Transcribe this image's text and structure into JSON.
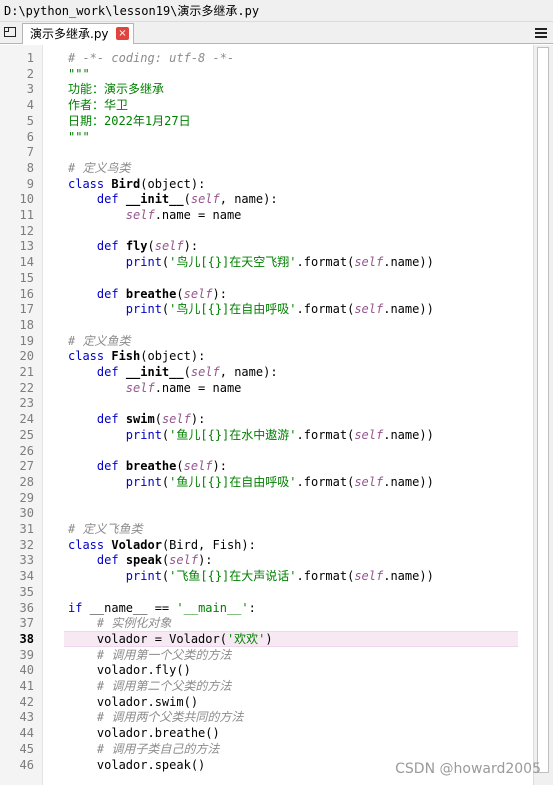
{
  "window": {
    "path": "D:\\python_work\\lesson19\\演示多继承.py"
  },
  "tab": {
    "label": "演示多继承.py",
    "close_glyph": "×"
  },
  "watermark": "CSDN @howard2005",
  "colors": {
    "keyword": "#0000c8",
    "string": "#008000",
    "comment": "#8c8c8c",
    "self": "#94558d",
    "current_line": "#f6e9f4",
    "close_button": "#e0443e"
  },
  "icons": [
    "window-icon",
    "close-icon",
    "menu-icon"
  ],
  "editor": {
    "current_line": 38,
    "lines": [
      {
        "n": "1",
        "t": [
          [
            "cm",
            "# -*- coding: utf-8 -*-"
          ]
        ]
      },
      {
        "n": "2",
        "t": [
          [
            "st",
            "\"\"\""
          ]
        ]
      },
      {
        "n": "3",
        "t": [
          [
            "st",
            "功能：演示多继承"
          ]
        ]
      },
      {
        "n": "4",
        "t": [
          [
            "st",
            "作者：华卫"
          ]
        ]
      },
      {
        "n": "5",
        "t": [
          [
            "st",
            "日期：2022年1月27日"
          ]
        ]
      },
      {
        "n": "6",
        "t": [
          [
            "st",
            "\"\"\""
          ]
        ]
      },
      {
        "n": "7",
        "t": []
      },
      {
        "n": "8",
        "t": [
          [
            "cm",
            "# 定义鸟类"
          ]
        ]
      },
      {
        "n": "9",
        "t": [
          [
            "kw",
            "class "
          ],
          [
            "fn",
            "Bird"
          ],
          [
            "",
            "(object):"
          ]
        ]
      },
      {
        "n": "10",
        "t": [
          [
            "",
            "    "
          ],
          [
            "kw",
            "def "
          ],
          [
            "fn",
            "__init__"
          ],
          [
            "",
            "("
          ],
          [
            "sf",
            "self"
          ],
          [
            "",
            ", name):"
          ]
        ]
      },
      {
        "n": "11",
        "t": [
          [
            "",
            "        "
          ],
          [
            "sf",
            "self"
          ],
          [
            "",
            ".name = name"
          ]
        ]
      },
      {
        "n": "12",
        "t": []
      },
      {
        "n": "13",
        "t": [
          [
            "",
            "    "
          ],
          [
            "kw",
            "def "
          ],
          [
            "fn",
            "fly"
          ],
          [
            "",
            "("
          ],
          [
            "sf",
            "self"
          ],
          [
            "",
            "):"
          ]
        ]
      },
      {
        "n": "14",
        "t": [
          [
            "",
            "        "
          ],
          [
            "kw",
            "print"
          ],
          [
            "",
            "("
          ],
          [
            "st",
            "'鸟儿[{}]在天空飞翔'"
          ],
          [
            "",
            ".format("
          ],
          [
            "sf",
            "self"
          ],
          [
            "",
            ".name))"
          ]
        ]
      },
      {
        "n": "15",
        "t": []
      },
      {
        "n": "16",
        "t": [
          [
            "",
            "    "
          ],
          [
            "kw",
            "def "
          ],
          [
            "fn",
            "breathe"
          ],
          [
            "",
            "("
          ],
          [
            "sf",
            "self"
          ],
          [
            "",
            "):"
          ]
        ]
      },
      {
        "n": "17",
        "t": [
          [
            "",
            "        "
          ],
          [
            "kw",
            "print"
          ],
          [
            "",
            "("
          ],
          [
            "st",
            "'鸟儿[{}]在自由呼吸'"
          ],
          [
            "",
            ".format("
          ],
          [
            "sf",
            "self"
          ],
          [
            "",
            ".name))"
          ]
        ]
      },
      {
        "n": "18",
        "t": []
      },
      {
        "n": "19",
        "t": [
          [
            "cm",
            "# 定义鱼类"
          ]
        ]
      },
      {
        "n": "20",
        "t": [
          [
            "kw",
            "class "
          ],
          [
            "fn",
            "Fish"
          ],
          [
            "",
            "(object):"
          ]
        ]
      },
      {
        "n": "21",
        "t": [
          [
            "",
            "    "
          ],
          [
            "kw",
            "def "
          ],
          [
            "fn",
            "__init__"
          ],
          [
            "",
            "("
          ],
          [
            "sf",
            "self"
          ],
          [
            "",
            ", name):"
          ]
        ]
      },
      {
        "n": "22",
        "t": [
          [
            "",
            "        "
          ],
          [
            "sf",
            "self"
          ],
          [
            "",
            ".name = name"
          ]
        ]
      },
      {
        "n": "23",
        "t": []
      },
      {
        "n": "24",
        "t": [
          [
            "",
            "    "
          ],
          [
            "kw",
            "def "
          ],
          [
            "fn",
            "swim"
          ],
          [
            "",
            "("
          ],
          [
            "sf",
            "self"
          ],
          [
            "",
            "):"
          ]
        ]
      },
      {
        "n": "25",
        "t": [
          [
            "",
            "        "
          ],
          [
            "kw",
            "print"
          ],
          [
            "",
            "("
          ],
          [
            "st",
            "'鱼儿[{}]在水中遨游'"
          ],
          [
            "",
            ".format("
          ],
          [
            "sf",
            "self"
          ],
          [
            "",
            ".name))"
          ]
        ]
      },
      {
        "n": "26",
        "t": []
      },
      {
        "n": "27",
        "t": [
          [
            "",
            "    "
          ],
          [
            "kw",
            "def "
          ],
          [
            "fn",
            "breathe"
          ],
          [
            "",
            "("
          ],
          [
            "sf",
            "self"
          ],
          [
            "",
            "):"
          ]
        ]
      },
      {
        "n": "28",
        "t": [
          [
            "",
            "        "
          ],
          [
            "kw",
            "print"
          ],
          [
            "",
            "("
          ],
          [
            "st",
            "'鱼儿[{}]在自由呼吸'"
          ],
          [
            "",
            ".format("
          ],
          [
            "sf",
            "self"
          ],
          [
            "",
            ".name))"
          ]
        ]
      },
      {
        "n": "29",
        "t": []
      },
      {
        "n": "30",
        "t": []
      },
      {
        "n": "31",
        "t": [
          [
            "cm",
            "# 定义飞鱼类"
          ]
        ]
      },
      {
        "n": "32",
        "t": [
          [
            "kw",
            "class "
          ],
          [
            "fn",
            "Volador"
          ],
          [
            "",
            "(Bird, Fish):"
          ]
        ]
      },
      {
        "n": "33",
        "t": [
          [
            "",
            "    "
          ],
          [
            "kw",
            "def "
          ],
          [
            "fn",
            "speak"
          ],
          [
            "",
            "("
          ],
          [
            "sf",
            "self"
          ],
          [
            "",
            "):"
          ]
        ]
      },
      {
        "n": "34",
        "t": [
          [
            "",
            "        "
          ],
          [
            "kw",
            "print"
          ],
          [
            "",
            "("
          ],
          [
            "st",
            "'飞鱼[{}]在大声说话'"
          ],
          [
            "",
            ".format("
          ],
          [
            "sf",
            "self"
          ],
          [
            "",
            ".name))"
          ]
        ]
      },
      {
        "n": "35",
        "t": []
      },
      {
        "n": "36",
        "t": [
          [
            "kw",
            "if "
          ],
          [
            "",
            "__name__ == "
          ],
          [
            "st",
            "'__main__'"
          ],
          [
            "",
            ":"
          ]
        ]
      },
      {
        "n": "37",
        "t": [
          [
            "",
            "    "
          ],
          [
            "cm",
            "# 实例化对象"
          ]
        ]
      },
      {
        "n": "38",
        "t": [
          [
            "",
            "    volador = Volador("
          ],
          [
            "st",
            "'欢欢'"
          ],
          [
            "",
            ")"
          ]
        ]
      },
      {
        "n": "39",
        "t": [
          [
            "",
            "    "
          ],
          [
            "cm",
            "# 调用第一个父类的方法"
          ]
        ]
      },
      {
        "n": "40",
        "t": [
          [
            "",
            "    volador.fly()"
          ]
        ]
      },
      {
        "n": "41",
        "t": [
          [
            "",
            "    "
          ],
          [
            "cm",
            "# 调用第二个父类的方法"
          ]
        ]
      },
      {
        "n": "42",
        "t": [
          [
            "",
            "    volador.swim()"
          ]
        ]
      },
      {
        "n": "43",
        "t": [
          [
            "",
            "    "
          ],
          [
            "cm",
            "# 调用两个父类共同的方法"
          ]
        ]
      },
      {
        "n": "44",
        "t": [
          [
            "",
            "    volador.breathe()"
          ]
        ]
      },
      {
        "n": "45",
        "t": [
          [
            "",
            "    "
          ],
          [
            "cm",
            "# 调用子类自己的方法"
          ]
        ]
      },
      {
        "n": "46",
        "t": [
          [
            "",
            "    volador.speak()"
          ]
        ]
      }
    ]
  }
}
